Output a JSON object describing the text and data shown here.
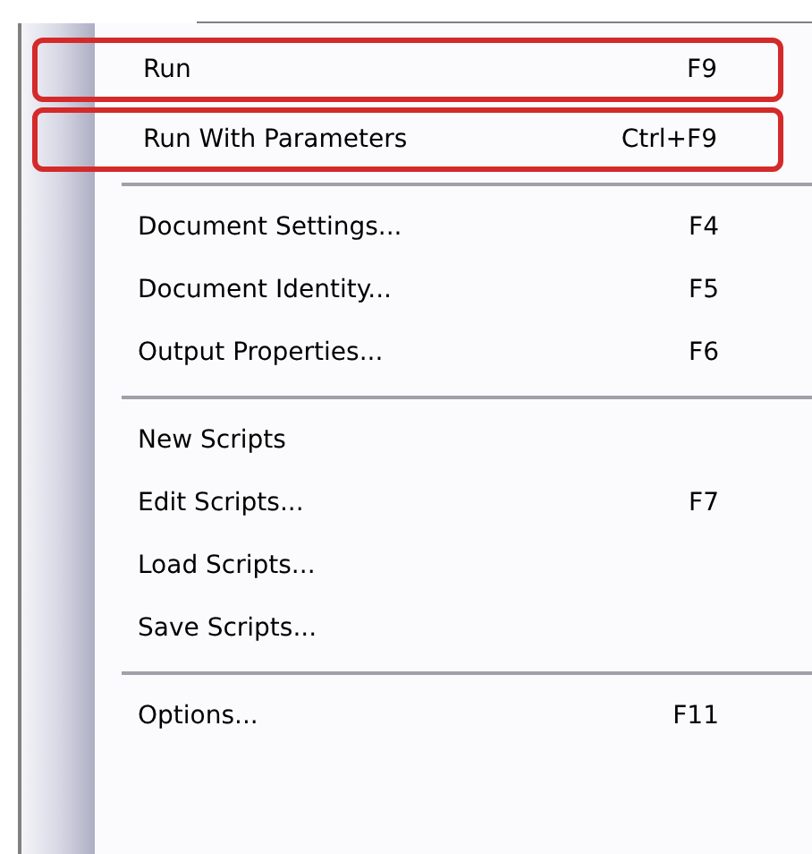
{
  "menu": {
    "groups": [
      {
        "items": [
          {
            "label": "Run",
            "shortcut": "F9",
            "highlighted": true
          },
          {
            "label": "Run With Parameters",
            "shortcut": "Ctrl+F9",
            "highlighted": true
          }
        ]
      },
      {
        "items": [
          {
            "label": "Document Settings...",
            "shortcut": "F4",
            "highlighted": false
          },
          {
            "label": "Document Identity...",
            "shortcut": "F5",
            "highlighted": false
          },
          {
            "label": "Output Properties...",
            "shortcut": "F6",
            "highlighted": false
          }
        ]
      },
      {
        "items": [
          {
            "label": "New Scripts",
            "highlighted": false
          },
          {
            "label": "Edit Scripts...",
            "shortcut": "F7",
            "highlighted": false
          },
          {
            "label": "Load Scripts...",
            "highlighted": false
          },
          {
            "label": "Save Scripts...",
            "highlighted": false
          }
        ]
      },
      {
        "items": [
          {
            "label": "Options...",
            "shortcut": "F11",
            "highlighted": false
          }
        ]
      }
    ]
  }
}
